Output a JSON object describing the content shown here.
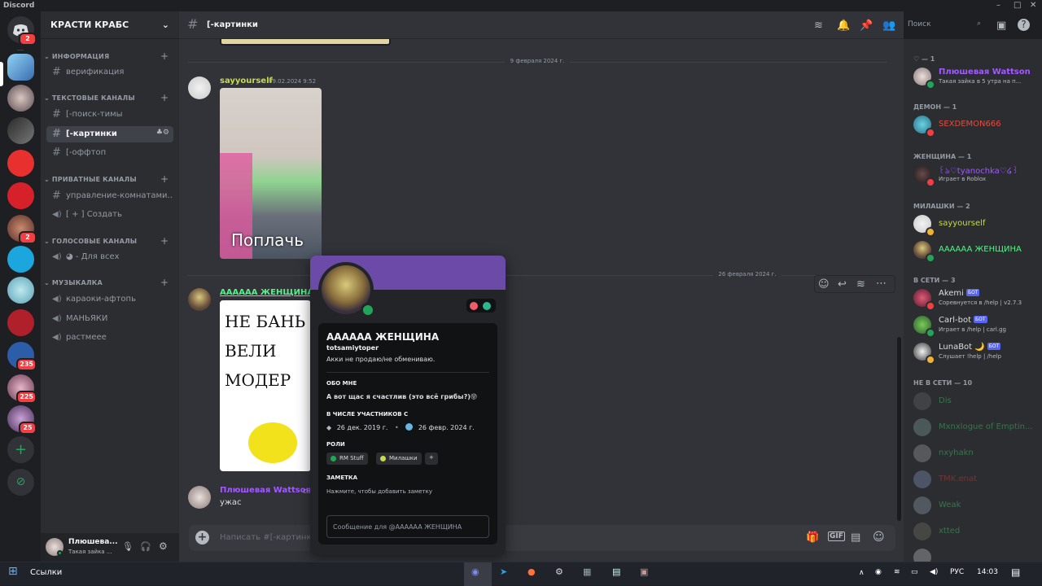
{
  "window": {
    "title": "Discord"
  },
  "guilds": {
    "dm_badge": "2",
    "badges": [
      "2",
      "235",
      "225",
      "25"
    ]
  },
  "server": {
    "name": "КРАСТИ КРАБС",
    "categories": {
      "info": "ИНФОРМАЦИЯ",
      "text": "ТЕКСТОВЫЕ КАНАЛЫ",
      "private": "ПРИВАТНЫЕ КАНАЛЫ",
      "voice": "ГОЛОСОВЫЕ КАНАЛЫ",
      "music": "МУЗЫКАЛКА"
    },
    "channels": {
      "verify": "верификация",
      "search": "[-поиск-тимы",
      "pics": "[-картинки",
      "offtop": "[-оффтоп",
      "rooms": "управление-комнатами...",
      "create": "[ + ] Создать",
      "forall": "◕ - Для всех",
      "karaoke": "караоки-афтопь",
      "maniacs": "МАНЬЯКИ",
      "rast": "растмеее"
    }
  },
  "user_panel": {
    "name": "Плюшева...",
    "status": "Такая зайка ..."
  },
  "channel_header": {
    "name": "[-картинки",
    "search_placeholder": "Поиск"
  },
  "messages": {
    "date1": "9 февраля 2024 г.",
    "date2": "26 февраля 2024 г.",
    "m1": {
      "author": "sayyourself",
      "time": "09.02.2024 9:52",
      "image_caption": "Поплачь"
    },
    "m2": {
      "author": "ААААAA ЖЕНЩИНА",
      "image_text": "НЕ БАНЬ ВЕЛИ МОДЕР"
    },
    "m3": {
      "author": "Плюшевая Wattson",
      "time": "Се",
      "text": "ужас"
    },
    "composer_placeholder": "Написать #[-картинки"
  },
  "profile": {
    "display_name": "ААААAA ЖЕНЩИНА",
    "username": "totsamiytoper",
    "bio": "Акки не продаю/не обмениваю.",
    "about_header": "ОБО МНЕ",
    "about": "А вот щас я счастлив (это всё грибы?)😝",
    "member_since_header": "В ЧИСЛЕ УЧАСТНИКОВ С",
    "discord_since": "26 дек. 2019 г.",
    "server_since": "26 февр. 2024 г.",
    "roles_header": "РОЛИ",
    "roles": [
      "RM Stuff",
      "Милашки"
    ],
    "role_add": "+",
    "note_header": "ЗАМЕТКА",
    "note_placeholder": "Нажмите, чтобы добавить заметку",
    "message_placeholder": "Сообщение для @ААААAA ЖЕНЩИНА"
  },
  "members": {
    "cat0": "♡ — 1",
    "m0": {
      "name": "Плюшевая Wattson",
      "status": "Такая зайка в 5 утра на п..."
    },
    "cat1": "ДЕМОН — 1",
    "m1": {
      "name": "SEXDEMON666"
    },
    "cat2": "ЖЕНЩИНА — 1",
    "m2": {
      "name": "꒰ঌ♡tyanochka♡໒꒱",
      "status": "Играет в Roblox"
    },
    "cat3": "МИЛАШКИ — 2",
    "m3": {
      "name": "sayyourself"
    },
    "m4": {
      "name": "ААААAA ЖЕНЩИНА"
    },
    "cat4": "В СЕТИ — 3",
    "m5": {
      "name": "Akemi",
      "status": "Соревнуется в /help | v2.7.3"
    },
    "m6": {
      "name": "Carl-bot",
      "status": "Играет в /help | carl.gg"
    },
    "m7": {
      "name": "LunaBot 🌙",
      "status": "Слушает !help | /help"
    },
    "bot_tag": "БОТ",
    "cat5": "НЕ В СЕТИ — 10",
    "off": [
      "Dis",
      "Mxnxlogue of Emptin...",
      "nxyhakn",
      "TMK.enat",
      "Weak",
      "xtted"
    ]
  },
  "taskbar": {
    "search_label": "Ссылки",
    "lang": "РУС",
    "time": "14:03"
  },
  "colors": {
    "purple": "#a259ff",
    "red": "#e74c3c",
    "green": "#57f287",
    "yellow": "#c8d94a",
    "blurple": "#5865f2"
  }
}
